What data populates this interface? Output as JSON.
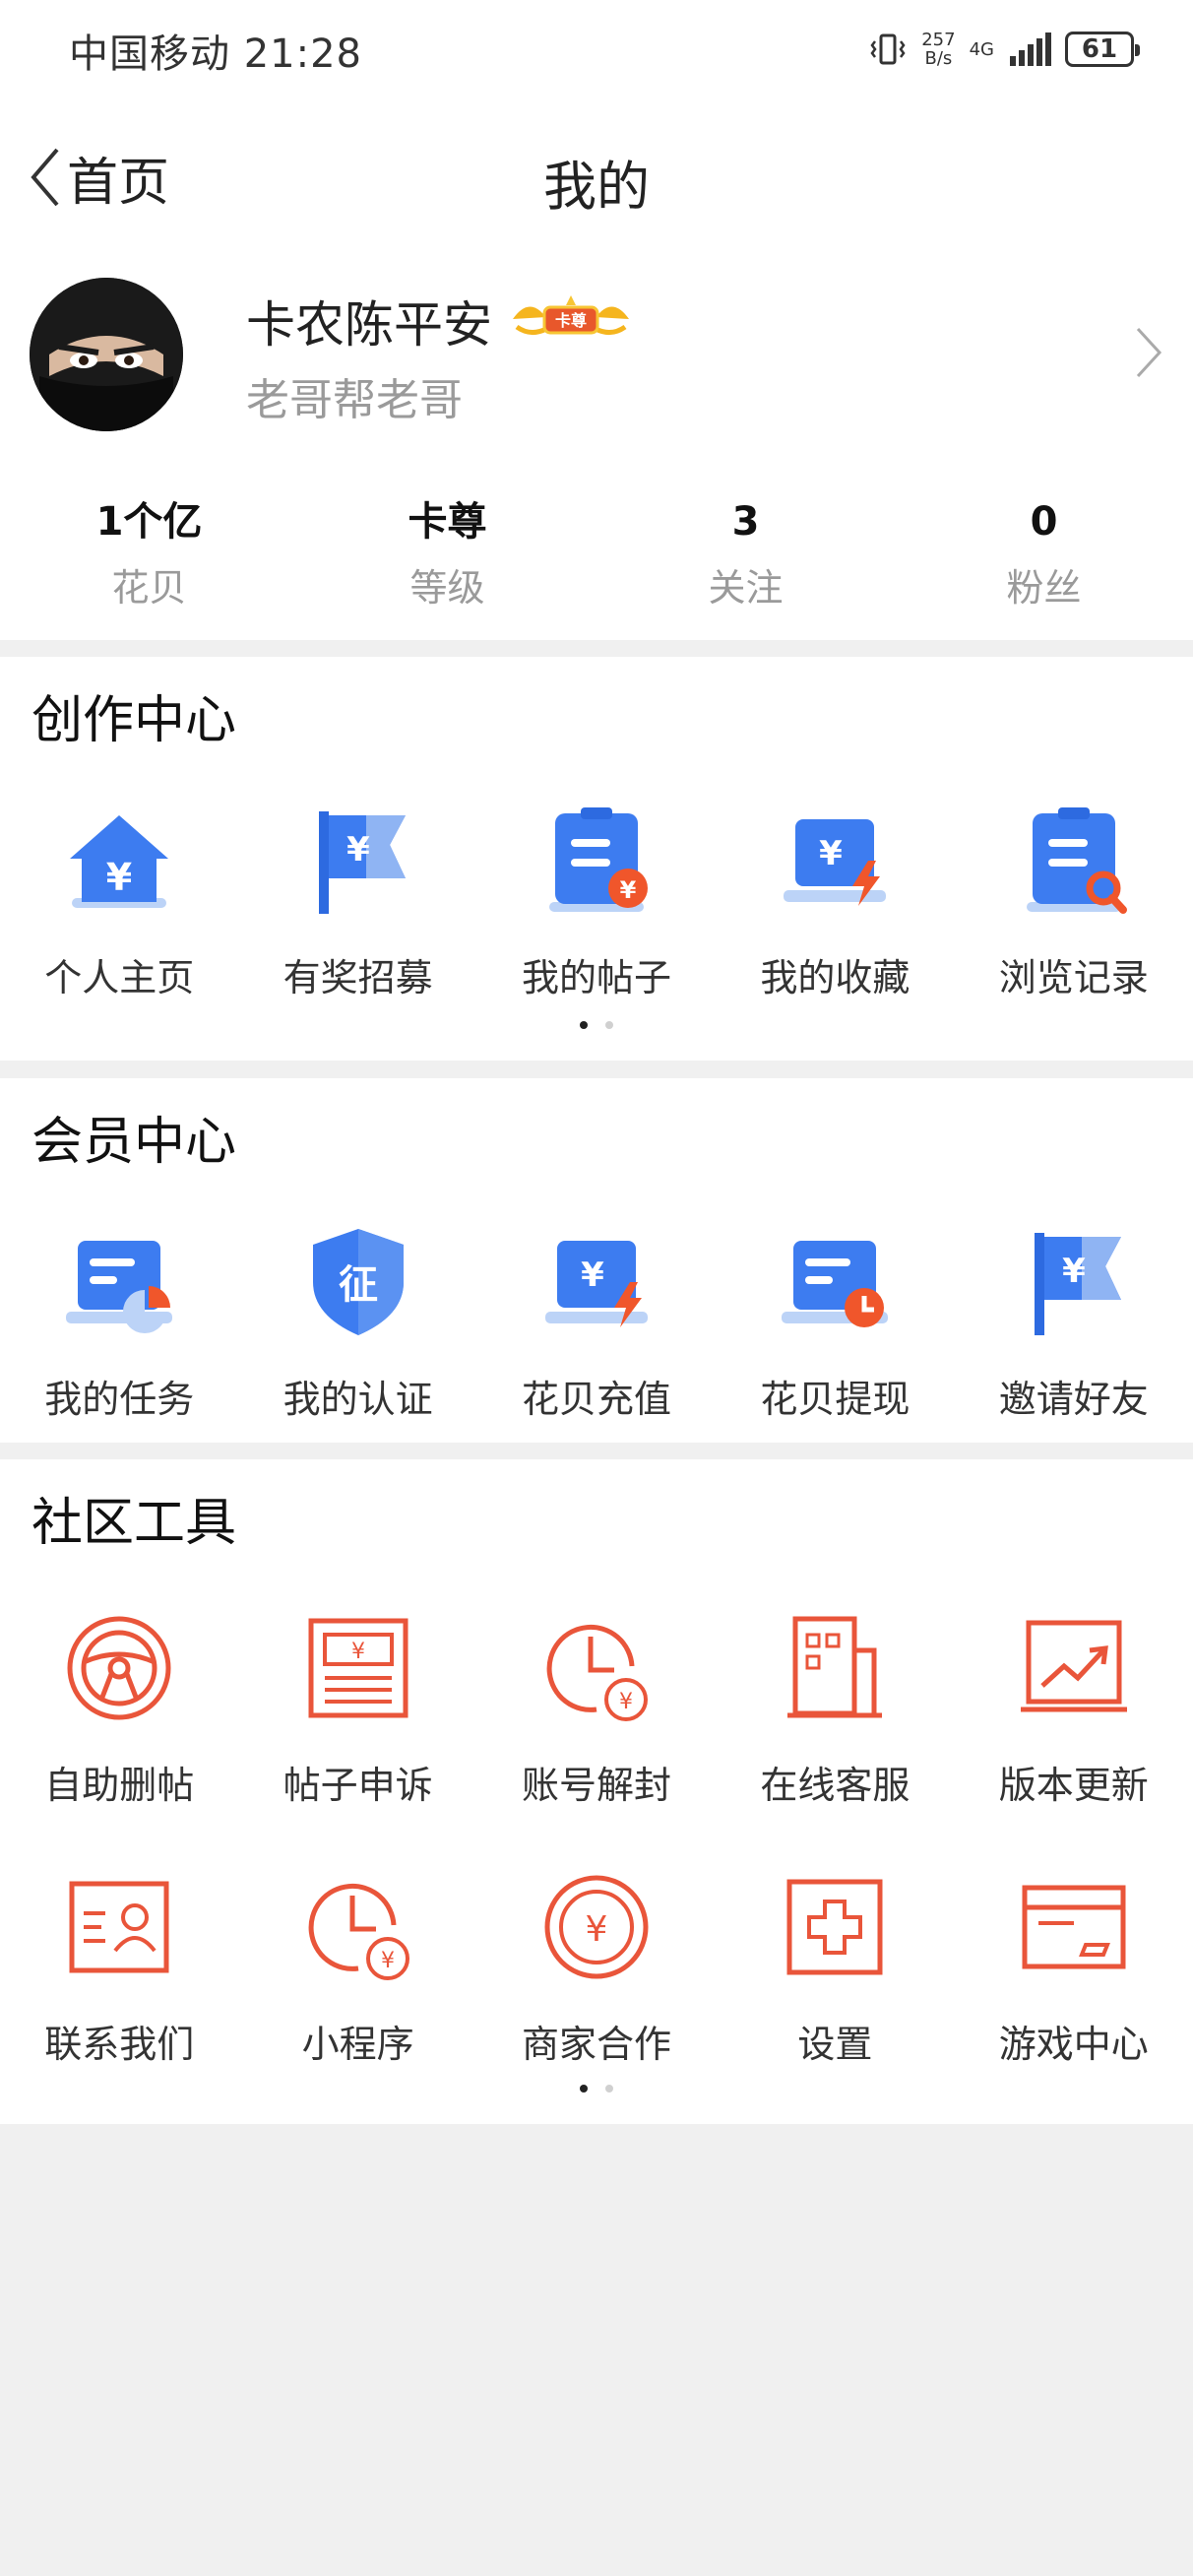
{
  "status_bar": {
    "carrier_time": "中国移动 21:28",
    "speed_value": "257",
    "speed_unit": "B/s",
    "network": "4G",
    "battery": "61"
  },
  "header": {
    "back_label": "首页",
    "title": "我的"
  },
  "profile": {
    "name": "卡农陈平安",
    "badge_text": "卡尊",
    "bio": "老哥帮老哥",
    "stats": [
      {
        "value": "1个亿",
        "label": "花贝"
      },
      {
        "value": "卡尊",
        "label": "等级"
      },
      {
        "value": "3",
        "label": "关注"
      },
      {
        "value": "0",
        "label": "粉丝"
      }
    ]
  },
  "creation_center": {
    "title": "创作中心",
    "items": [
      {
        "label": "个人主页",
        "icon": "home-yuan-icon"
      },
      {
        "label": "有奖招募",
        "icon": "flag-yuan-icon"
      },
      {
        "label": "我的帖子",
        "icon": "clipboard-yuan-icon"
      },
      {
        "label": "我的收藏",
        "icon": "laptop-bolt-icon"
      },
      {
        "label": "浏览记录",
        "icon": "clipboard-search-icon"
      }
    ]
  },
  "member_center": {
    "title": "会员中心",
    "items": [
      {
        "label": "我的任务",
        "icon": "card-pie-icon"
      },
      {
        "label": "我的认证",
        "icon": "shield-verify-icon"
      },
      {
        "label": "花贝充值",
        "icon": "laptop-bolt-icon"
      },
      {
        "label": "花贝提现",
        "icon": "card-clock-icon"
      },
      {
        "label": "邀请好友",
        "icon": "flag-yuan-icon"
      }
    ]
  },
  "community_tools": {
    "title": "社区工具",
    "row1": [
      {
        "label": "自助删帖",
        "icon": "steering-wheel-icon"
      },
      {
        "label": "帖子申诉",
        "icon": "banknote-icon"
      },
      {
        "label": "账号解封",
        "icon": "clock-yuan-icon"
      },
      {
        "label": "在线客服",
        "icon": "building-icon"
      },
      {
        "label": "版本更新",
        "icon": "chart-up-icon"
      }
    ],
    "row2": [
      {
        "label": "联系我们",
        "icon": "id-card-icon"
      },
      {
        "label": "小程序",
        "icon": "clock-yuan-icon"
      },
      {
        "label": "商家合作",
        "icon": "coin-yuan-icon"
      },
      {
        "label": "设置",
        "icon": "medical-cross-icon"
      },
      {
        "label": "游戏中心",
        "icon": "credit-card-icon"
      }
    ]
  },
  "colors": {
    "blue": "#3d7cf0",
    "blue_light": "#bcd3f7",
    "orange": "#f0562b",
    "tool_red": "#e9553a"
  }
}
